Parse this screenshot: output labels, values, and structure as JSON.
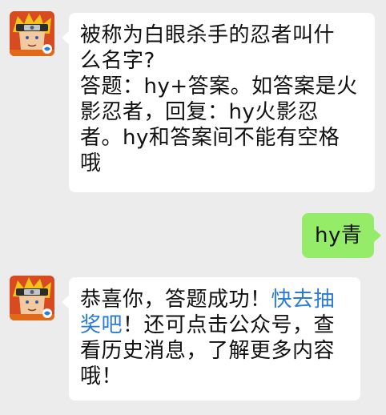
{
  "chat": {
    "messages": [
      {
        "sender": "bot",
        "avatar": "naruto-avatar",
        "lines": [
          "被称为白眼杀手的忍者叫什",
          "么名字?",
          "答题：hy+答案。如答案是火",
          "影忍者，回复：hy火影忍",
          "者。hy和答案间不能有空格",
          "哦"
        ]
      },
      {
        "sender": "me",
        "text": "hy青"
      },
      {
        "sender": "bot",
        "avatar": "naruto-avatar",
        "line1_plain": "恭喜你，答题成功！",
        "line1_link": "快去抽",
        "line2_link": "奖吧",
        "line2_plain": "！还可点击公众号，查",
        "line3": "看历史消息，了解更多内容",
        "line4": "哦！"
      }
    ]
  },
  "colors": {
    "background": "#ececec",
    "incoming_bubble": "#ffffff",
    "outgoing_bubble": "#95ec69",
    "link": "#2a7bd6"
  }
}
